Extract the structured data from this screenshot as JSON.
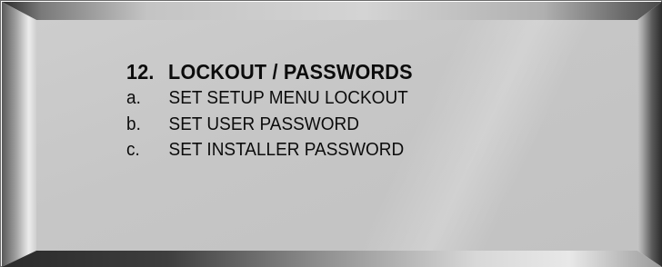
{
  "menu": {
    "title": {
      "number": "12.",
      "text": "LOCKOUT / PASSWORDS"
    },
    "items": [
      {
        "letter": "a.",
        "label": "SET SETUP MENU LOCKOUT"
      },
      {
        "letter": "b.",
        "label": "SET USER PASSWORD"
      },
      {
        "letter": "c.",
        "label": "SET INSTALLER PASSWORD"
      }
    ]
  },
  "colors": {
    "screen": "#c6c6c6",
    "text": "#0c0c0c",
    "frame_dark": "#2a2a2a",
    "frame_light": "#e8e8e8"
  }
}
